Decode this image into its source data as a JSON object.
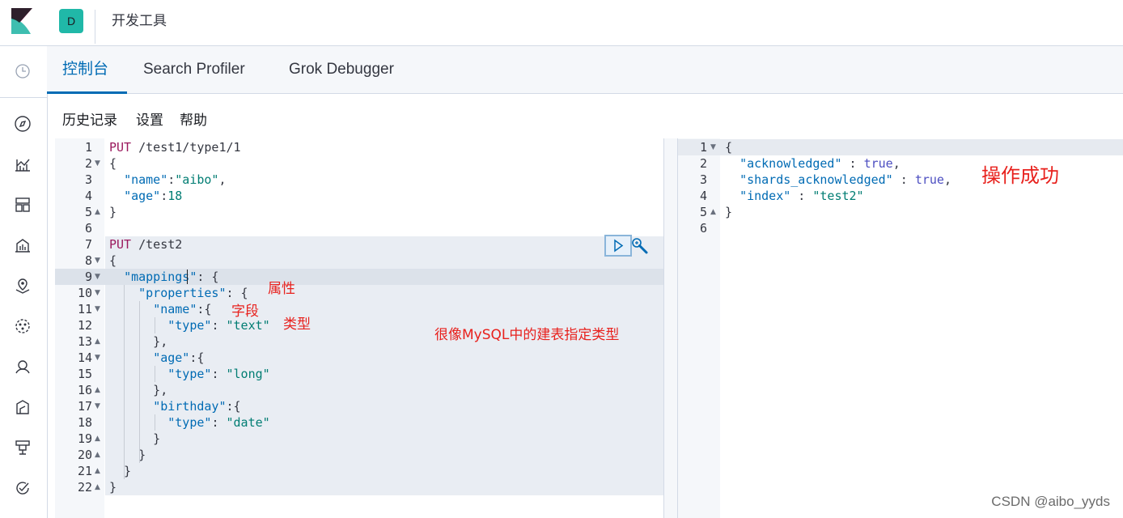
{
  "header": {
    "space_initial": "D",
    "app_title": "开发工具"
  },
  "left_nav": {
    "icons": [
      "clock-icon",
      "compass-icon",
      "visualize-icon",
      "dashboard-icon",
      "canvas-icon",
      "maps-icon",
      "ml-icon",
      "graph-icon",
      "apm-icon",
      "infra-icon",
      "uptime-icon"
    ]
  },
  "tabs": [
    {
      "label": "控制台",
      "active": true
    },
    {
      "label": "Search Profiler",
      "active": false
    },
    {
      "label": "Grok Debugger",
      "active": false
    }
  ],
  "menu": {
    "history": "历史记录",
    "settings": "设置",
    "help": "帮助"
  },
  "request_editor": {
    "line_numbers": [
      "1",
      "2",
      "3",
      "4",
      "5",
      "6",
      "7",
      "8",
      "9",
      "10",
      "11",
      "12",
      "13",
      "14",
      "15",
      "16",
      "17",
      "18",
      "19",
      "20",
      "21",
      "22"
    ],
    "lines": [
      [
        [
          "method",
          "PUT"
        ],
        [
          "path",
          " /test1/type1/1"
        ]
      ],
      [
        [
          "punc",
          "{"
        ]
      ],
      [
        [
          "punc",
          "  "
        ],
        [
          "prop",
          "\"name\""
        ],
        [
          "punc",
          ":"
        ],
        [
          "str",
          "\"aibo\""
        ],
        [
          "punc",
          ","
        ]
      ],
      [
        [
          "punc",
          "  "
        ],
        [
          "prop",
          "\"age\""
        ],
        [
          "punc",
          ":"
        ],
        [
          "num",
          "18"
        ]
      ],
      [
        [
          "punc",
          "}"
        ]
      ],
      [],
      [
        [
          "method",
          "PUT"
        ],
        [
          "path",
          " /test2"
        ]
      ],
      [
        [
          "punc",
          "{"
        ]
      ],
      [
        [
          "punc",
          "  "
        ],
        [
          "prop",
          "\"mappings\""
        ],
        [
          "punc",
          ": {"
        ]
      ],
      [
        [
          "punc",
          "    "
        ],
        [
          "prop",
          "\"properties\""
        ],
        [
          "punc",
          ": {"
        ]
      ],
      [
        [
          "punc",
          "      "
        ],
        [
          "prop",
          "\"name\""
        ],
        [
          "punc",
          ":{"
        ]
      ],
      [
        [
          "punc",
          "        "
        ],
        [
          "prop",
          "\"type\""
        ],
        [
          "punc",
          ": "
        ],
        [
          "str",
          "\"text\""
        ]
      ],
      [
        [
          "punc",
          "      },"
        ]
      ],
      [
        [
          "punc",
          "      "
        ],
        [
          "prop",
          "\"age\""
        ],
        [
          "punc",
          ":{"
        ]
      ],
      [
        [
          "punc",
          "        "
        ],
        [
          "prop",
          "\"type\""
        ],
        [
          "punc",
          ": "
        ],
        [
          "str",
          "\"long\""
        ]
      ],
      [
        [
          "punc",
          "      },"
        ]
      ],
      [
        [
          "punc",
          "      "
        ],
        [
          "prop",
          "\"birthday\""
        ],
        [
          "punc",
          ":{"
        ]
      ],
      [
        [
          "punc",
          "        "
        ],
        [
          "prop",
          "\"type\""
        ],
        [
          "punc",
          ": "
        ],
        [
          "str",
          "\"date\""
        ]
      ],
      [
        [
          "punc",
          "      }"
        ]
      ],
      [
        [
          "punc",
          "    }"
        ]
      ],
      [
        [
          "punc",
          "  }"
        ]
      ],
      [
        [
          "punc",
          "}"
        ]
      ]
    ],
    "fold_markers": {
      "2": "down",
      "5": "up",
      "8": "down",
      "9": "down",
      "10": "down",
      "11": "down",
      "13": "up",
      "14": "down",
      "16": "up",
      "17": "down",
      "19": "up",
      "20": "up",
      "21": "up",
      "22": "up"
    }
  },
  "response_editor": {
    "line_numbers": [
      "1",
      "2",
      "3",
      "4",
      "5",
      "6"
    ],
    "lines": [
      [
        [
          "punc",
          "{"
        ]
      ],
      [
        [
          "punc",
          "  "
        ],
        [
          "prop",
          "\"acknowledged\""
        ],
        [
          "punc",
          " : "
        ],
        [
          "bool",
          "true"
        ],
        [
          "punc",
          ","
        ]
      ],
      [
        [
          "punc",
          "  "
        ],
        [
          "prop",
          "\"shards_acknowledged\""
        ],
        [
          "punc",
          " : "
        ],
        [
          "bool",
          "true"
        ],
        [
          "punc",
          ","
        ]
      ],
      [
        [
          "punc",
          "  "
        ],
        [
          "prop",
          "\"index\""
        ],
        [
          "punc",
          " : "
        ],
        [
          "str",
          "\"test2\""
        ]
      ],
      [
        [
          "punc",
          "}"
        ]
      ],
      []
    ],
    "fold_markers": {
      "1": "down",
      "5": "up"
    }
  },
  "annotations": {
    "properties": "属性",
    "field": "字段",
    "type": "类型",
    "mysql_note": "很像MySQL中的建表指定类型",
    "success": "操作成功"
  },
  "watermark": "CSDN @aibo_yyds",
  "colors": {
    "accent": "#006bb4",
    "annotation": "#e8211d",
    "space_badge": "#20b8a8"
  }
}
